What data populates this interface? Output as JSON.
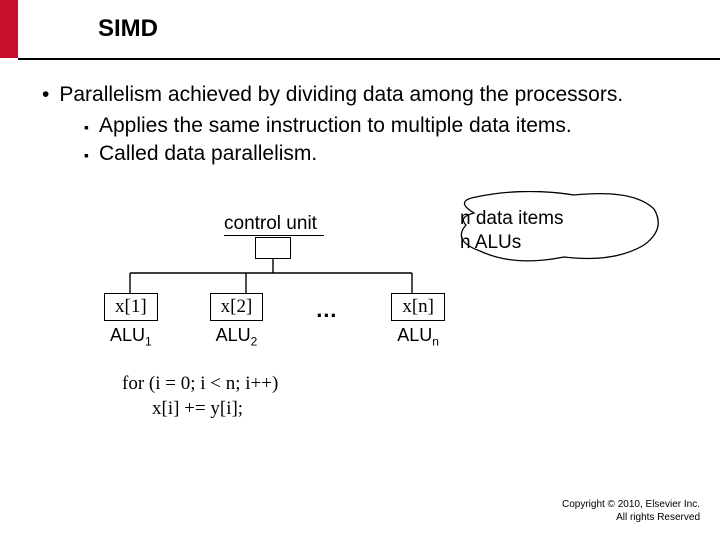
{
  "title": "SIMD",
  "bullets": {
    "l1_text": "Parallelism achieved by dividing data among the processors.",
    "l2a": "Applies the same instruction to multiple data items.",
    "l2b": "Called data parallelism."
  },
  "diagram": {
    "control_label": "control unit",
    "n_text_line1": "n data items",
    "n_text_line2": "n ALUs",
    "items": {
      "x1": "x[1]",
      "a1_prefix": "ALU",
      "a1_sub": "1",
      "x2": "x[2]",
      "a2_prefix": "ALU",
      "a2_sub": "2",
      "dots": "…",
      "xn": "x[n]",
      "an_prefix": "ALU",
      "an_sub": "n"
    },
    "code_line1": "for (i = 0; i < n; i++)",
    "code_line2": "x[i] += y[i];"
  },
  "copyright": {
    "line1": "Copyright © 2010, Elsevier Inc.",
    "line2": "All rights Reserved"
  }
}
